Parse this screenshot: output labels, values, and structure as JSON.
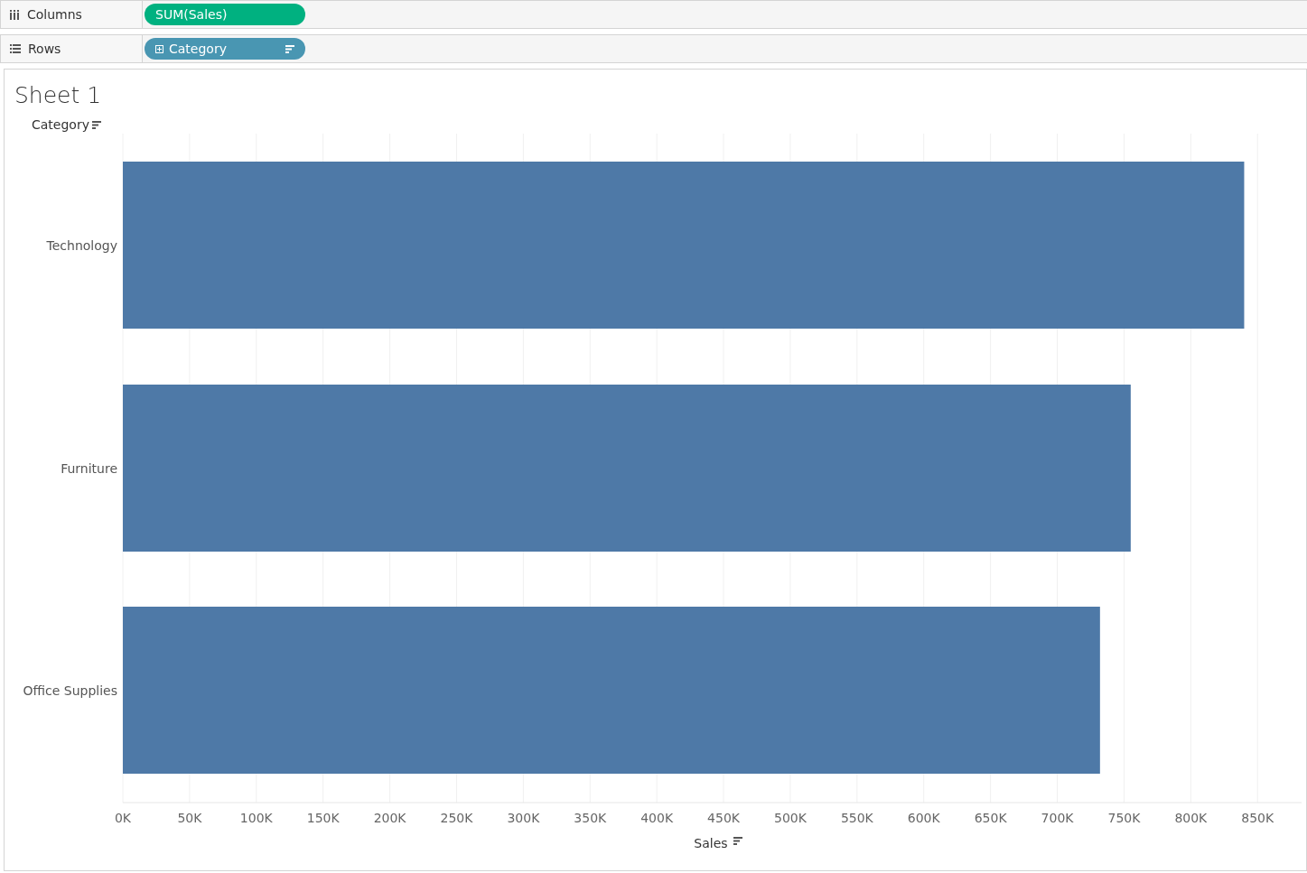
{
  "shelves": [
    {
      "kind": "columns",
      "label": "Columns",
      "pill": {
        "text": "SUM(Sales)",
        "kind": "measure",
        "sorted": false,
        "expandable": false
      }
    },
    {
      "kind": "rows",
      "label": "Rows",
      "pill": {
        "text": "Category",
        "kind": "dimension",
        "sorted": true,
        "expandable": true
      }
    }
  ],
  "sheet": {
    "title": "Sheet 1",
    "chart_data": {
      "type": "bar",
      "orientation": "horizontal",
      "xlabel": "Sales",
      "ylabel": "Category",
      "categories": [
        "Technology",
        "Furniture",
        "Office Supplies"
      ],
      "series": [
        {
          "color": "#4e79a7",
          "values": [
            840000,
            755000,
            732000
          ]
        }
      ],
      "xlim": [
        0,
        883000
      ],
      "grid": true,
      "xticks": [
        {
          "value": 0,
          "label": "0K"
        },
        {
          "value": 50000,
          "label": "50K"
        },
        {
          "value": 100000,
          "label": "100K"
        },
        {
          "value": 150000,
          "label": "150K"
        },
        {
          "value": 200000,
          "label": "200K"
        },
        {
          "value": 250000,
          "label": "250K"
        },
        {
          "value": 300000,
          "label": "300K"
        },
        {
          "value": 350000,
          "label": "350K"
        },
        {
          "value": 400000,
          "label": "400K"
        },
        {
          "value": 450000,
          "label": "450K"
        },
        {
          "value": 500000,
          "label": "500K"
        },
        {
          "value": 550000,
          "label": "550K"
        },
        {
          "value": 600000,
          "label": "600K"
        },
        {
          "value": 650000,
          "label": "650K"
        },
        {
          "value": 700000,
          "label": "700K"
        },
        {
          "value": 750000,
          "label": "750K"
        },
        {
          "value": 800000,
          "label": "800K"
        },
        {
          "value": 850000,
          "label": "850K"
        }
      ]
    }
  }
}
